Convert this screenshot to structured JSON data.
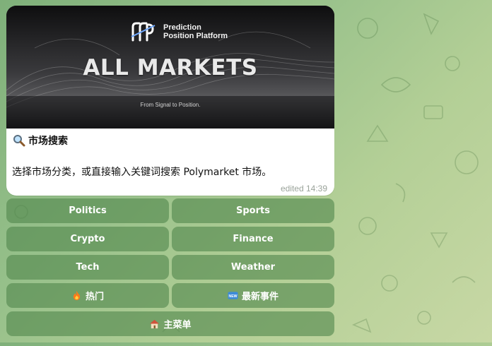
{
  "message": {
    "banner": {
      "brand_line1": "Prediction",
      "brand_line2": "Position Platform",
      "title": "ALL MARKETS",
      "tagline": "From Signal to Position."
    },
    "title": "市场搜索",
    "title_icon": "magnifier-icon",
    "body": "选择市场分类，或直接输入关键词搜索 Polymarket 市场。",
    "meta": "edited 14:39"
  },
  "keyboard": {
    "rows": [
      [
        {
          "label": "Politics"
        },
        {
          "label": "Sports"
        }
      ],
      [
        {
          "label": "Crypto"
        },
        {
          "label": "Finance"
        }
      ],
      [
        {
          "label": "Tech"
        },
        {
          "label": "Weather"
        }
      ],
      [
        {
          "label": "热门",
          "icon": "fire-icon"
        },
        {
          "label": "最新事件",
          "icon": "new-badge-icon"
        }
      ],
      [
        {
          "label": "主菜单",
          "icon": "house-icon"
        }
      ]
    ]
  },
  "colors": {
    "wallpaper": "#96c08a",
    "button": "#53874e",
    "bubble": "#ffffff",
    "meta": "#9aa39a"
  }
}
